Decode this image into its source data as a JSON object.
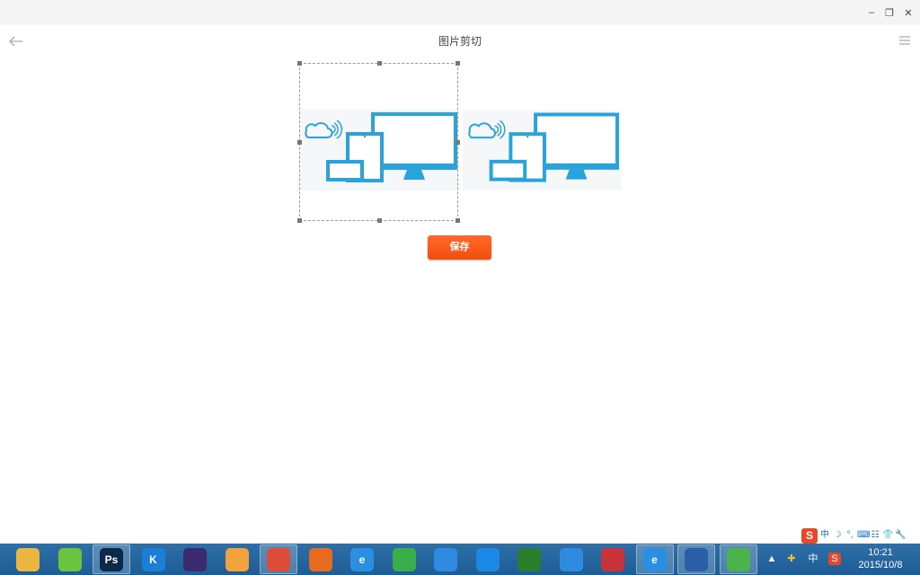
{
  "window": {
    "minimize_glyph": "–",
    "restore_glyph": "❐",
    "close_glyph": "✕"
  },
  "appbar": {
    "title": "图片剪切",
    "back_icon": "arrow-left-icon",
    "menu_icon": "hamburger-menu-icon"
  },
  "editor": {
    "save_label": "保存",
    "accent_color": "#f55a1a",
    "illustration_color": "#29a3dc"
  },
  "ime_toolbar": {
    "logo": "S",
    "items": [
      "中",
      "☽",
      "°,",
      "⌨",
      "☷",
      "👕",
      "🔧"
    ]
  },
  "taskbar": {
    "apps": [
      {
        "name": "file-explorer-icon",
        "label": "",
        "color": "#e9b73d"
      },
      {
        "name": "leaf-app-icon",
        "label": "",
        "color": "#6cc33c"
      },
      {
        "name": "photoshop-icon",
        "label": "Ps",
        "color": "#0b2a4a"
      },
      {
        "name": "k-app-icon",
        "label": "K",
        "color": "#1b7fd8"
      },
      {
        "name": "eclipse-icon",
        "label": "",
        "color": "#3b2a6d"
      },
      {
        "name": "color-leaf-icon",
        "label": "",
        "color": "#f1a23b"
      },
      {
        "name": "chrome-icon",
        "label": "",
        "color": "#dd4b39"
      },
      {
        "name": "firefox-icon",
        "label": "",
        "color": "#e66a1f"
      },
      {
        "name": "ie-icon",
        "label": "e",
        "color": "#2a8fe0"
      },
      {
        "name": "green-arrow-icon",
        "label": "",
        "color": "#38b04a"
      },
      {
        "name": "cloud-icon",
        "label": "",
        "color": "#2f8be0"
      },
      {
        "name": "baidu-cloud-icon",
        "label": "",
        "color": "#1a88e5"
      },
      {
        "name": "eye-app-icon",
        "label": "",
        "color": "#2a7d2a"
      },
      {
        "name": "pen-app-icon",
        "label": "",
        "color": "#2f8be0"
      },
      {
        "name": "red-app-icon",
        "label": "",
        "color": "#c8333a"
      },
      {
        "name": "ie-icon-2",
        "label": "e",
        "color": "#2a8fe0"
      },
      {
        "name": "computer-icon",
        "label": "",
        "color": "#2a5fa8"
      },
      {
        "name": "wechat-icon",
        "label": "",
        "color": "#4bb34b"
      }
    ]
  },
  "tray": {
    "items": [
      "▲",
      "✚",
      "中",
      "S"
    ]
  },
  "clock": {
    "time": "10:21",
    "date": "2015/10/8"
  }
}
